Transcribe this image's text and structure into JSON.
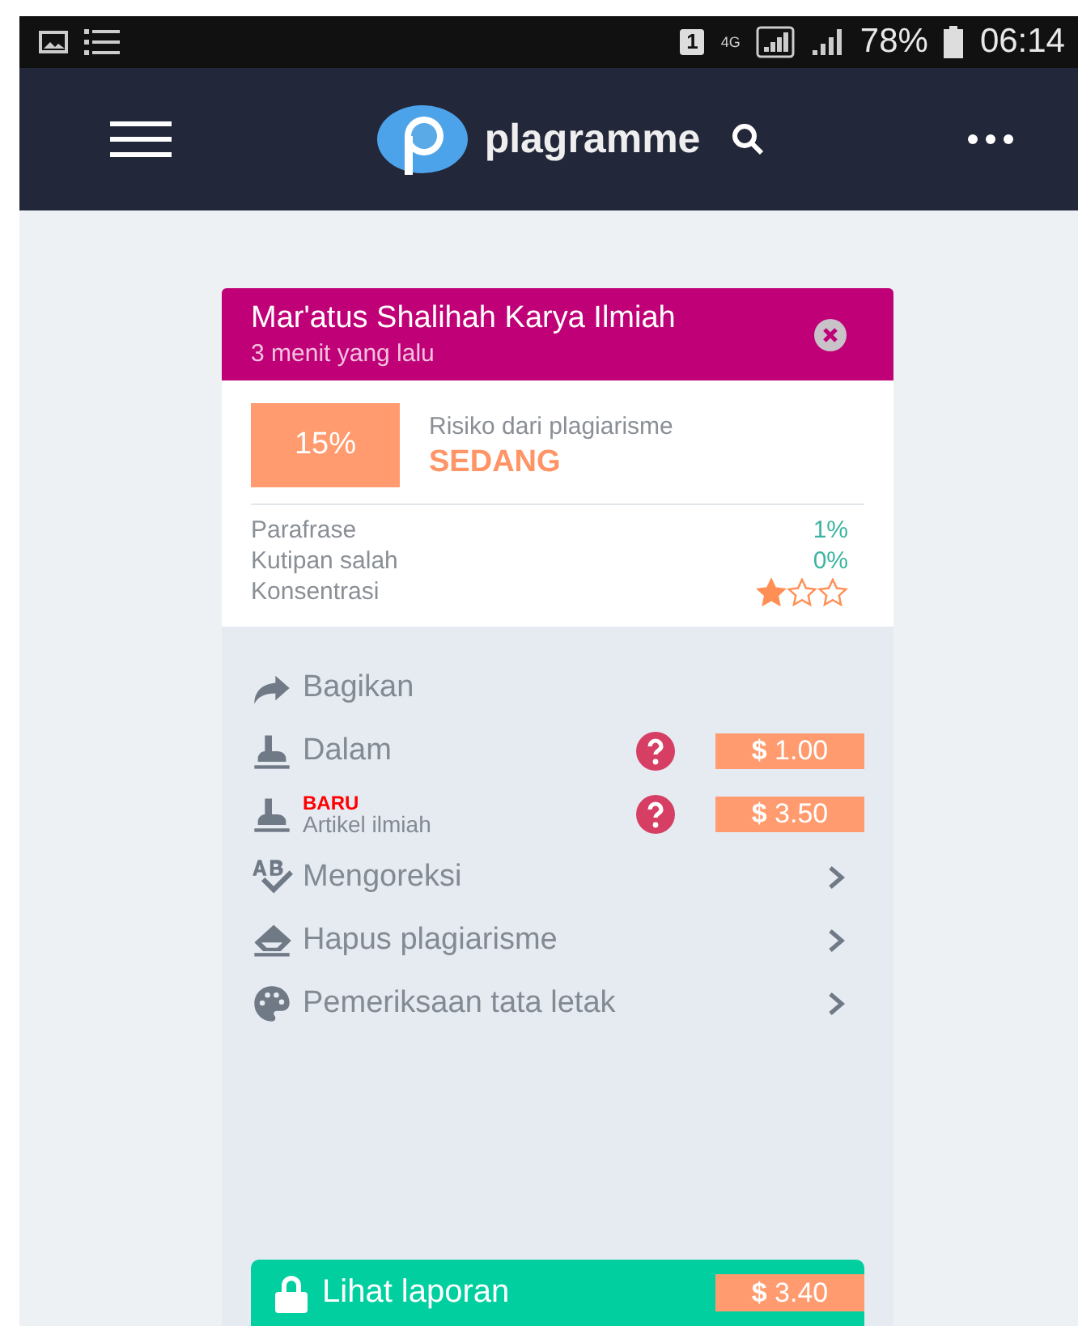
{
  "status_bar": {
    "sim_slot": "1",
    "network": "4G",
    "battery": "78%",
    "time": "06:14"
  },
  "app_bar": {
    "brand": "plagramme"
  },
  "card": {
    "title": "Mar'atus Shalihah Karya Ilmiah",
    "subtitle": "3 menit yang lalu",
    "score": "15%",
    "risk_label": "Risiko dari plagiarisme",
    "risk_level": "SEDANG",
    "stats": [
      {
        "kind": "value",
        "label": "Parafrase",
        "value": "1%"
      },
      {
        "kind": "value",
        "label": "Kutipan salah",
        "value": "0%"
      },
      {
        "kind": "stars",
        "label": "Konsentrasi",
        "stars": 1
      }
    ],
    "actions": [
      {
        "kind": "plain",
        "label": "Bagikan"
      },
      {
        "kind": "price",
        "label": "Dalam",
        "price": "**$** 1.00"
      },
      {
        "kind": "price",
        "badge": "BARU",
        "label": "Artikel ilmiah",
        "price": "**$** 3.50"
      },
      {
        "kind": "nav",
        "label": "Mengoreksi"
      },
      {
        "kind": "nav",
        "label": "Hapus plagiarisme"
      },
      {
        "kind": "nav",
        "label": "Pemeriksaan tata letak"
      }
    ],
    "report_button": {
      "label": "Lihat laporan",
      "price": "**$** 3.40"
    }
  }
}
